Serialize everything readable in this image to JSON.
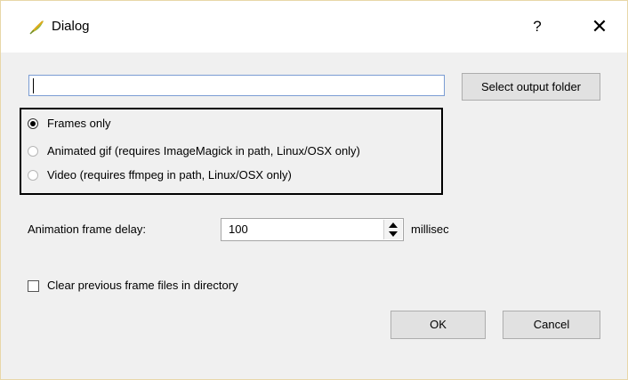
{
  "window": {
    "title": "Dialog",
    "help_label": "?",
    "close_label": "✕",
    "icon": "qgis-leaf-icon"
  },
  "output": {
    "path_value": "",
    "select_folder_label": "Select output folder"
  },
  "format": {
    "options": [
      {
        "label": "Frames only",
        "checked": true
      },
      {
        "label": "Animated gif (requires ImageMagick in path, Linux/OSX only)",
        "checked": false
      },
      {
        "label": "Video (requires ffmpeg in path, Linux/OSX only)",
        "checked": false
      }
    ]
  },
  "delay": {
    "label": "Animation frame delay:",
    "value": "100",
    "unit": "millisec"
  },
  "clear_frames": {
    "label": "Clear previous frame files in directory",
    "checked": false
  },
  "buttons": {
    "ok": "OK",
    "cancel": "Cancel"
  },
  "colors": {
    "input_focus_border": "#7a9cd3",
    "button_face": "#e1e1e1",
    "dialog_background": "#f0f0f0"
  }
}
